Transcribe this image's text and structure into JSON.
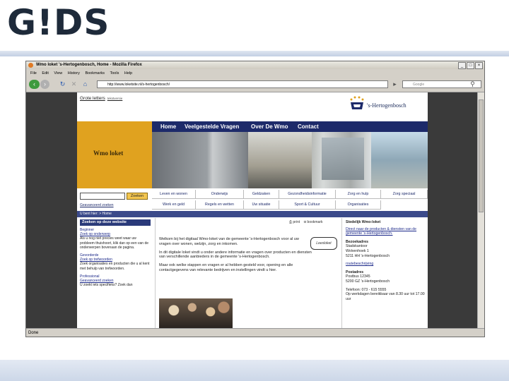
{
  "slide": {
    "logo": "G!DS"
  },
  "browser": {
    "title": "Wmo loket 's-Hertogenbosch, Home - Mozilla Firefox",
    "menu": [
      "File",
      "Edit",
      "View",
      "History",
      "Bookmarks",
      "Tools",
      "Help"
    ],
    "url": "http://www.loketsite.nl/s-hertogenbosch/",
    "search_placeholder": "Google",
    "status": "Done"
  },
  "site": {
    "grote_letters": "Grote letters",
    "grote_letters_sub": "tekstversie",
    "city_name": "'s-Hertogenbosch",
    "nav": [
      "Home",
      "Veelgestelde Vragen",
      "Over De Wmo",
      "Contact"
    ],
    "wmo_label": "Wmo loket",
    "search_button": "Zoeken",
    "advanced_search": "Geavanceerd zoeken",
    "topics_row1": [
      "Leven en wonen",
      "Onderwijs",
      "Geldzaken",
      "Gezondheidsinformatie",
      "Zorg en hulp",
      "Zorg speciaal"
    ],
    "topics_row2": [
      "Werk en geld",
      "Regels en wetten",
      "Uw situatie",
      "Sport & Cultuur",
      "Organisaties"
    ],
    "breadcrumb": "U bent hier: > Home",
    "left_heading": "Zoeken op deze website",
    "left": {
      "beginner": "Beginner",
      "beginner_link": "Zoek op onderwerp",
      "beginner_text": "Als u nog niet precies weet waar uw probleem thuishoort, klik dan op een van de onderwerpen bovenaan de pagina.",
      "gevorderde": "Gevorderde",
      "gevorderde_link": "Zoek op trefwoorden",
      "gevorderde_text": "Zoek organisaties en producten die u al kent met behulp van trefwoorden.",
      "professional": "Professional",
      "professional_link": "Geavanceerd zoeken",
      "professional_text": "U zoekt iets specifieks? Zoek dan"
    },
    "print": "print",
    "bookmark": "bookmark",
    "main_p1": "Welkom bij het digitaal Wmo-loket van de gemeente 's-Hertogenbosch voor al uw vragen over wonen, welzijn, zorg en inkomen.",
    "main_p2": "In dit digitale loket vindt u onder andere informatie en vragen over producten en diensten van verschillende aanbieders in de gemeente 's-Hertogenbosch.",
    "main_p3": "Maar ook welke stappen en vragen er al hebben gesteld voor, opening en alle contactgegevens van relevante bedrijven en instellingen vindt u hier.",
    "badge": "Leesloket",
    "right": {
      "heading": "Stedelijk Wmo-loket",
      "link": "Direct naar de producten & diensten van de gemeente 's-Hertogenbosch.",
      "bezoek": "Bezoekadres",
      "addr1": "Stadskantoor",
      "addr2": "Wolvenhoek 1",
      "addr3": "5211 HH 's-Hertogenbosch",
      "route": "routebeschrijving",
      "post": "Postadres",
      "post1": "Postbus 12345",
      "post2": "5200 GZ 's-Hertogenbosch",
      "tel": "Telefoon: 073 - 615 5555",
      "tel2": "Op werkdagen bereikbaar van 8.30 uur tot 17.00 uur"
    }
  }
}
